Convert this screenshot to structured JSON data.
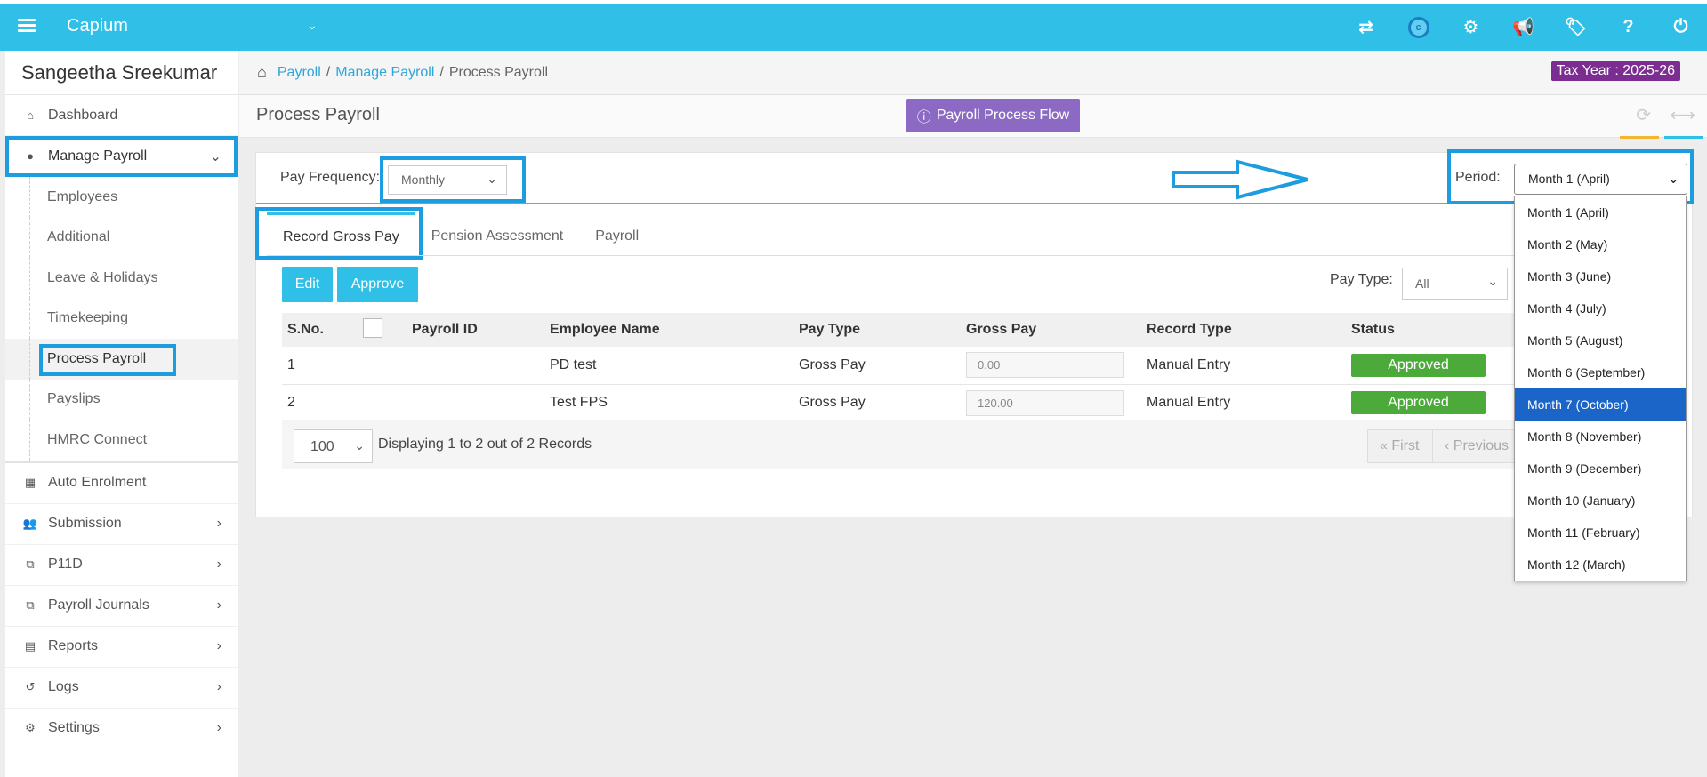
{
  "app": {
    "brand": "Capium"
  },
  "user": {
    "name": "Sangeetha Sreekumar"
  },
  "header": {
    "tax_year": "Tax Year : 2025-26",
    "icons": [
      "transfer-icon",
      "capium-logo-icon",
      "apps-icon",
      "megaphone-icon",
      "tag-icon",
      "help-icon",
      "power-icon"
    ],
    "help_glyph": "?",
    "logo_letter": "c"
  },
  "sidebar": {
    "items": [
      {
        "label": "Dashboard",
        "icon": "home-icon"
      },
      {
        "label": "Manage Payroll",
        "icon": "user-icon"
      }
    ],
    "sub_items": [
      "Employees",
      "Additional",
      "Leave & Holidays",
      "Timekeeping",
      "Process Payroll",
      "Payslips",
      "HMRC Connect"
    ],
    "lower_items": [
      {
        "label": "Auto Enrolment",
        "icon": "grid-icon"
      },
      {
        "label": "Submission",
        "icon": "users-icon"
      },
      {
        "label": "P11D",
        "icon": "copy-icon"
      },
      {
        "label": "Payroll Journals",
        "icon": "copy-icon"
      },
      {
        "label": "Reports",
        "icon": "report-icon"
      },
      {
        "label": "Logs",
        "icon": "history-icon"
      },
      {
        "label": "Settings",
        "icon": "gear-icon"
      }
    ]
  },
  "breadcrumb": {
    "items": [
      "Payroll",
      "Manage Payroll",
      "Process Payroll"
    ],
    "separator": "/"
  },
  "page": {
    "title": "Process Payroll",
    "flow_button": "Payroll Process Flow"
  },
  "filters": {
    "pay_frequency_label": "Pay Frequency:",
    "pay_frequency_value": "Monthly",
    "period_label": "Period:",
    "period_value": "Month 1 (April)"
  },
  "tabs": [
    "Record Gross Pay",
    "Pension Assessment",
    "Payroll"
  ],
  "actions": {
    "edit": "Edit",
    "approve": "Approve",
    "pay_type_label": "Pay Type:",
    "pay_type_value": "All"
  },
  "table": {
    "headers": [
      "S.No.",
      "",
      "Payroll ID",
      "Employee Name",
      "Pay Type",
      "Gross Pay",
      "Record Type",
      "Status"
    ],
    "rows": [
      {
        "sno": "1",
        "payroll_id": "",
        "employee": "PD test",
        "pay_type": "Gross Pay",
        "gross_pay": "0.00",
        "record_type": "Manual Entry",
        "status": "Approved"
      },
      {
        "sno": "2",
        "payroll_id": "",
        "employee": "Test FPS",
        "pay_type": "Gross Pay",
        "gross_pay": "120.00",
        "record_type": "Manual Entry",
        "status": "Approved"
      }
    ]
  },
  "pagination": {
    "page_size": "100",
    "display_text": "Displaying 1 to 2 out of 2 Records",
    "first": "« First",
    "previous": "‹ Previous"
  },
  "period_dropdown": {
    "options": [
      "Month 1 (April)",
      "Month 2 (May)",
      "Month 3 (June)",
      "Month 4 (July)",
      "Month 5 (August)",
      "Month 6 (September)",
      "Month 7 (October)",
      "Month 8 (November)",
      "Month 9 (December)",
      "Month 10 (January)",
      "Month 11 (February)",
      "Month 12 (March)"
    ],
    "highlighted": "Month 7 (October)"
  },
  "colors": {
    "topbar": "#2fbfe7",
    "accent": "#2fbfe7",
    "tax_year_bg": "#7c2d91",
    "flow_button": "#8c6ac4",
    "approved": "#4caa3a",
    "highlight_box": "#1d9ddf",
    "dropdown_selected": "#1b65c9"
  }
}
